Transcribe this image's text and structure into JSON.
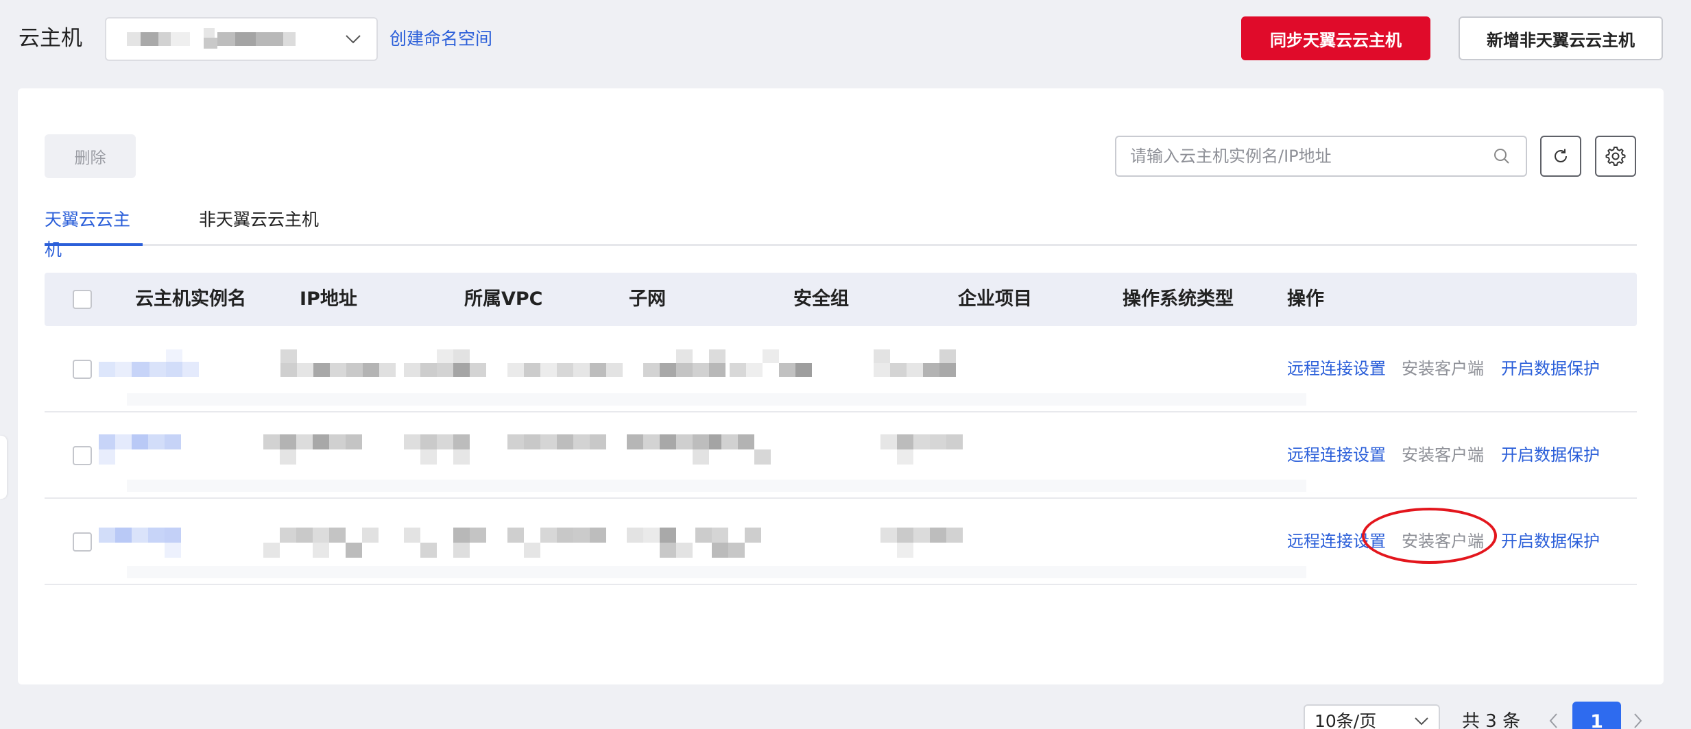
{
  "header": {
    "title": "云主机",
    "namespace_select_value": "",
    "create_namespace_label": "创建命名空间",
    "sync_button_label": "同步天翼云云主机",
    "add_button_label": "新增非天翼云云主机"
  },
  "toolbar": {
    "delete_label": "删除",
    "search_placeholder": "请输入云主机实例名/IP地址",
    "refresh_icon": "refresh-icon",
    "settings_icon": "gear-icon"
  },
  "tabs": [
    {
      "label": "天翼云云主机",
      "active": true
    },
    {
      "label": "非天翼云云主机",
      "active": false
    }
  ],
  "table": {
    "columns": [
      "云主机实例名",
      "IP地址",
      "所属VPC",
      "子网",
      "安全组",
      "企业项目",
      "操作系统类型",
      "操作"
    ],
    "rows": [
      {
        "actions": [
          "远程连接设置",
          "安装客户端",
          "开启数据保护"
        ]
      },
      {
        "actions": [
          "远程连接设置",
          "安装客户端",
          "开启数据保护"
        ]
      },
      {
        "actions": [
          "远程连接设置",
          "安装客户端",
          "开启数据保护"
        ]
      }
    ]
  },
  "pagination": {
    "page_size": "10条/页",
    "total": "共 3 条",
    "current_page": "1"
  },
  "colors": {
    "primary_blue": "#2b5fd9",
    "sync_red": "#e00b2a",
    "annotation_red": "#e3161d"
  }
}
